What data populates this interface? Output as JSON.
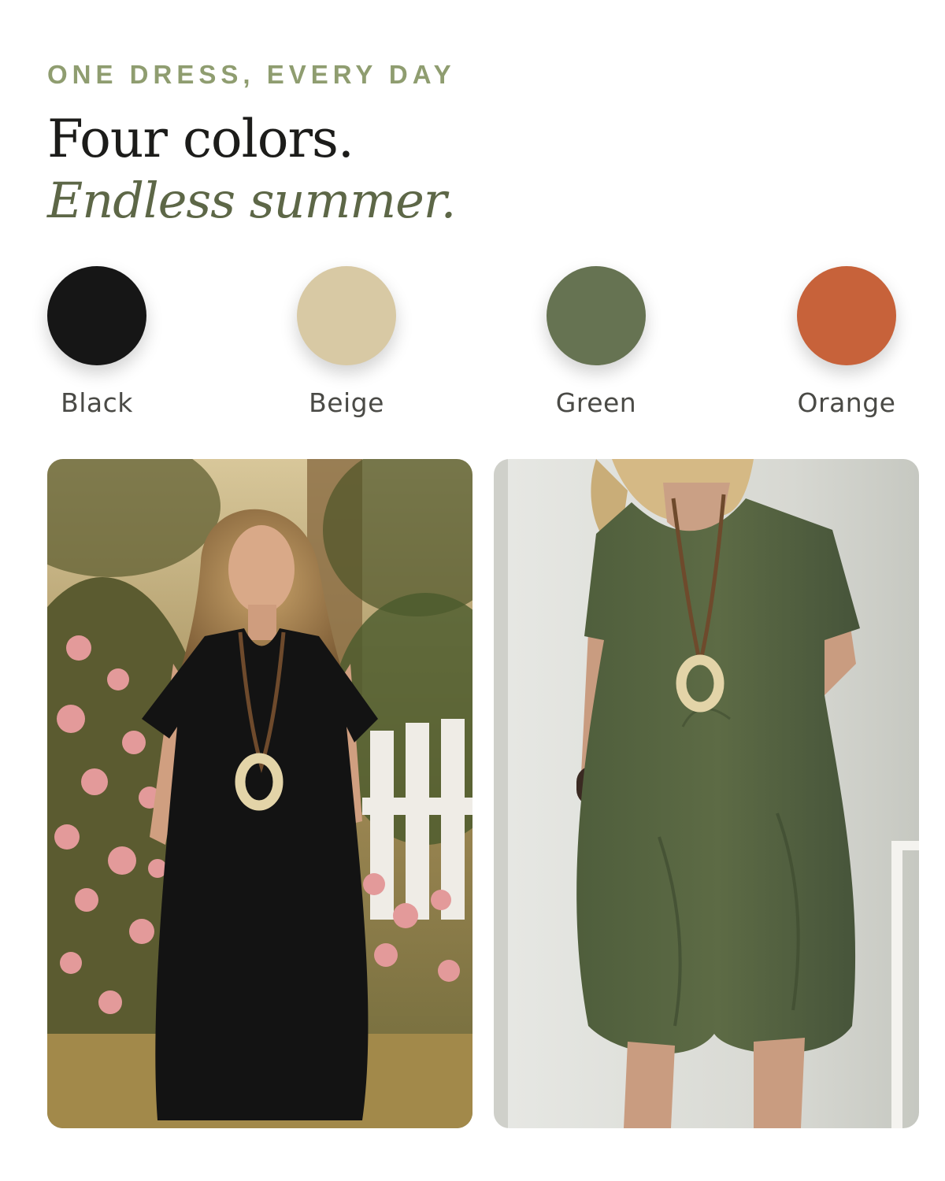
{
  "eyebrow": "ONE DRESS, EVERY DAY",
  "headline": "Four colors.",
  "subhead": "Endless summer.",
  "swatches": [
    {
      "label": "Black",
      "color": "#161616"
    },
    {
      "label": "Beige",
      "color": "#d8c9a4"
    },
    {
      "label": "Green",
      "color": "#667352"
    },
    {
      "label": "Orange",
      "color": "#c7623a"
    }
  ],
  "colors": {
    "eyebrow": "#8f9d70",
    "subhead": "#5d6747",
    "headline": "#1c1c1a"
  }
}
